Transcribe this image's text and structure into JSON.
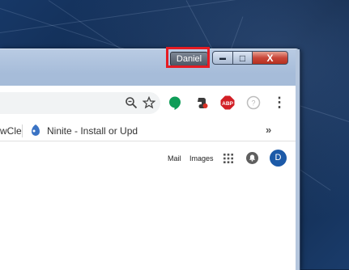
{
  "titlebar": {
    "profile_name": "Daniel",
    "minimize_glyph": "▬",
    "maximize_glyph": "□",
    "close_glyph": "X",
    "highlight_color": "#e51b23"
  },
  "toolbar": {
    "zoom_icon": "zoom-icon",
    "star_icon": "bookmark-star-icon",
    "extensions": [
      "hangouts-icon",
      "evernote-icon",
      "adblock-plus-icon",
      "help-icon",
      "menu-icon"
    ],
    "abp_label": "ABP",
    "menu_glyph": "⋮"
  },
  "bookmarks": {
    "truncated_label": "wCle",
    "ninite_label": "Ninite - Install or Upd",
    "overflow_glyph": "»"
  },
  "page": {
    "mail_label": "Mail",
    "images_label": "Images",
    "avatar_letter": "D"
  }
}
